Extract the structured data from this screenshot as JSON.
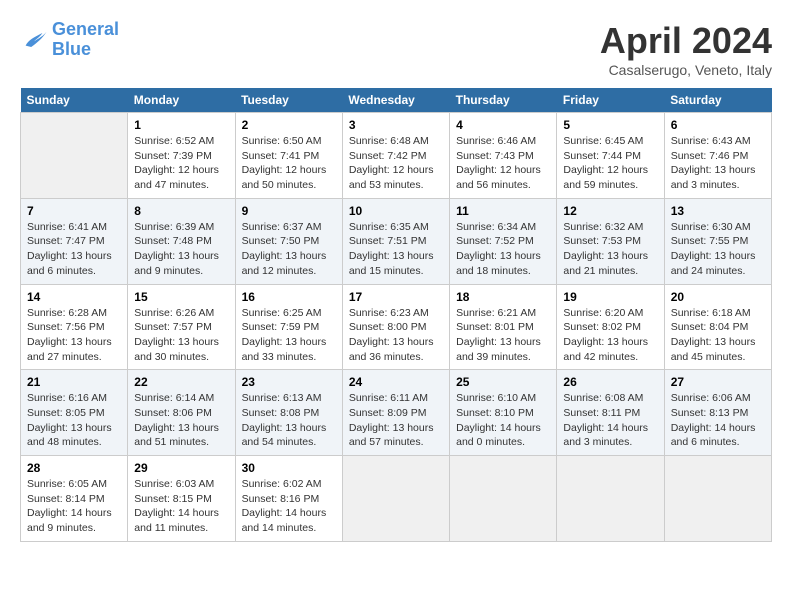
{
  "header": {
    "logo_line1": "General",
    "logo_line2": "Blue",
    "title": "April 2024",
    "location": "Casalserugo, Veneto, Italy"
  },
  "days_of_week": [
    "Sunday",
    "Monday",
    "Tuesday",
    "Wednesday",
    "Thursday",
    "Friday",
    "Saturday"
  ],
  "weeks": [
    [
      {
        "day": "",
        "info": ""
      },
      {
        "day": "1",
        "info": "Sunrise: 6:52 AM\nSunset: 7:39 PM\nDaylight: 12 hours\nand 47 minutes."
      },
      {
        "day": "2",
        "info": "Sunrise: 6:50 AM\nSunset: 7:41 PM\nDaylight: 12 hours\nand 50 minutes."
      },
      {
        "day": "3",
        "info": "Sunrise: 6:48 AM\nSunset: 7:42 PM\nDaylight: 12 hours\nand 53 minutes."
      },
      {
        "day": "4",
        "info": "Sunrise: 6:46 AM\nSunset: 7:43 PM\nDaylight: 12 hours\nand 56 minutes."
      },
      {
        "day": "5",
        "info": "Sunrise: 6:45 AM\nSunset: 7:44 PM\nDaylight: 12 hours\nand 59 minutes."
      },
      {
        "day": "6",
        "info": "Sunrise: 6:43 AM\nSunset: 7:46 PM\nDaylight: 13 hours\nand 3 minutes."
      }
    ],
    [
      {
        "day": "7",
        "info": "Sunrise: 6:41 AM\nSunset: 7:47 PM\nDaylight: 13 hours\nand 6 minutes."
      },
      {
        "day": "8",
        "info": "Sunrise: 6:39 AM\nSunset: 7:48 PM\nDaylight: 13 hours\nand 9 minutes."
      },
      {
        "day": "9",
        "info": "Sunrise: 6:37 AM\nSunset: 7:50 PM\nDaylight: 13 hours\nand 12 minutes."
      },
      {
        "day": "10",
        "info": "Sunrise: 6:35 AM\nSunset: 7:51 PM\nDaylight: 13 hours\nand 15 minutes."
      },
      {
        "day": "11",
        "info": "Sunrise: 6:34 AM\nSunset: 7:52 PM\nDaylight: 13 hours\nand 18 minutes."
      },
      {
        "day": "12",
        "info": "Sunrise: 6:32 AM\nSunset: 7:53 PM\nDaylight: 13 hours\nand 21 minutes."
      },
      {
        "day": "13",
        "info": "Sunrise: 6:30 AM\nSunset: 7:55 PM\nDaylight: 13 hours\nand 24 minutes."
      }
    ],
    [
      {
        "day": "14",
        "info": "Sunrise: 6:28 AM\nSunset: 7:56 PM\nDaylight: 13 hours\nand 27 minutes."
      },
      {
        "day": "15",
        "info": "Sunrise: 6:26 AM\nSunset: 7:57 PM\nDaylight: 13 hours\nand 30 minutes."
      },
      {
        "day": "16",
        "info": "Sunrise: 6:25 AM\nSunset: 7:59 PM\nDaylight: 13 hours\nand 33 minutes."
      },
      {
        "day": "17",
        "info": "Sunrise: 6:23 AM\nSunset: 8:00 PM\nDaylight: 13 hours\nand 36 minutes."
      },
      {
        "day": "18",
        "info": "Sunrise: 6:21 AM\nSunset: 8:01 PM\nDaylight: 13 hours\nand 39 minutes."
      },
      {
        "day": "19",
        "info": "Sunrise: 6:20 AM\nSunset: 8:02 PM\nDaylight: 13 hours\nand 42 minutes."
      },
      {
        "day": "20",
        "info": "Sunrise: 6:18 AM\nSunset: 8:04 PM\nDaylight: 13 hours\nand 45 minutes."
      }
    ],
    [
      {
        "day": "21",
        "info": "Sunrise: 6:16 AM\nSunset: 8:05 PM\nDaylight: 13 hours\nand 48 minutes."
      },
      {
        "day": "22",
        "info": "Sunrise: 6:14 AM\nSunset: 8:06 PM\nDaylight: 13 hours\nand 51 minutes."
      },
      {
        "day": "23",
        "info": "Sunrise: 6:13 AM\nSunset: 8:08 PM\nDaylight: 13 hours\nand 54 minutes."
      },
      {
        "day": "24",
        "info": "Sunrise: 6:11 AM\nSunset: 8:09 PM\nDaylight: 13 hours\nand 57 minutes."
      },
      {
        "day": "25",
        "info": "Sunrise: 6:10 AM\nSunset: 8:10 PM\nDaylight: 14 hours\nand 0 minutes."
      },
      {
        "day": "26",
        "info": "Sunrise: 6:08 AM\nSunset: 8:11 PM\nDaylight: 14 hours\nand 3 minutes."
      },
      {
        "day": "27",
        "info": "Sunrise: 6:06 AM\nSunset: 8:13 PM\nDaylight: 14 hours\nand 6 minutes."
      }
    ],
    [
      {
        "day": "28",
        "info": "Sunrise: 6:05 AM\nSunset: 8:14 PM\nDaylight: 14 hours\nand 9 minutes."
      },
      {
        "day": "29",
        "info": "Sunrise: 6:03 AM\nSunset: 8:15 PM\nDaylight: 14 hours\nand 11 minutes."
      },
      {
        "day": "30",
        "info": "Sunrise: 6:02 AM\nSunset: 8:16 PM\nDaylight: 14 hours\nand 14 minutes."
      },
      {
        "day": "",
        "info": ""
      },
      {
        "day": "",
        "info": ""
      },
      {
        "day": "",
        "info": ""
      },
      {
        "day": "",
        "info": ""
      }
    ]
  ]
}
